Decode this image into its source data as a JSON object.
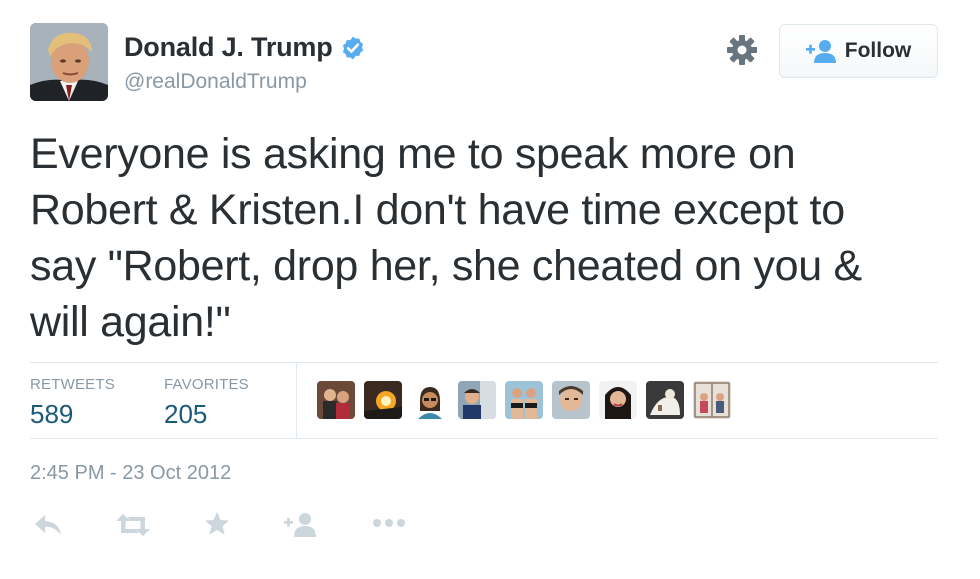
{
  "user": {
    "display_name": "Donald J. Trump",
    "handle": "@realDonaldTrump",
    "verified": true
  },
  "header": {
    "settings_icon": "gear-icon",
    "follow_label": "Follow"
  },
  "tweet": {
    "text_lines": [
      "Everyone is asking me to speak more on",
      "Robert & Kristen.I don't have time except to",
      "say \"Robert, drop her, she cheated on you &",
      "will again!\""
    ],
    "timestamp": "2:45 PM - 23 Oct 2012"
  },
  "stats": {
    "retweets_label": "RETWEETS",
    "retweets_value": "589",
    "favorites_label": "FAVORITES",
    "favorites_value": "205"
  },
  "favoriters": [
    "avatar-1",
    "avatar-2",
    "avatar-3",
    "avatar-4",
    "avatar-5",
    "avatar-6",
    "avatar-7",
    "avatar-8",
    "avatar-9"
  ],
  "actions": [
    "reply-icon",
    "retweet-icon",
    "favorite-icon",
    "follow-icon",
    "more-icon"
  ],
  "colors": {
    "text": "#292f33",
    "muted": "#8899a6",
    "count": "#1b5a7a",
    "verified": "#55acee",
    "border": "#e1e8ed"
  }
}
